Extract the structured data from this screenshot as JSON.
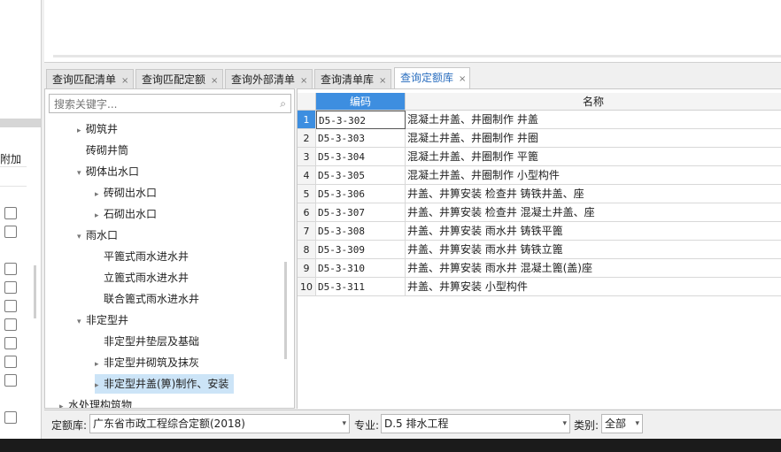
{
  "left_strip": {
    "column_label": "附加"
  },
  "tabs": [
    {
      "label": "查询匹配清单",
      "close": "×"
    },
    {
      "label": "查询匹配定额",
      "close": "×"
    },
    {
      "label": "查询外部清单",
      "close": "×"
    },
    {
      "label": "查询清单库",
      "close": "×"
    },
    {
      "label": "查询定额库",
      "close": "×",
      "active": true
    }
  ],
  "search": {
    "placeholder": "搜索关键字...",
    "icon": "search-icon"
  },
  "tree": [
    {
      "label": "砌筑井",
      "arrow": "▸",
      "indent": 1
    },
    {
      "label": "砖砌井筒",
      "arrow": "",
      "indent": 1
    },
    {
      "label": "砌体出水口",
      "arrow": "▾",
      "indent": 1
    },
    {
      "label": "砖砌出水口",
      "arrow": "▸",
      "indent": 2
    },
    {
      "label": "石砌出水口",
      "arrow": "▸",
      "indent": 2
    },
    {
      "label": "雨水口",
      "arrow": "▾",
      "indent": 1
    },
    {
      "label": "平篦式雨水进水井",
      "arrow": "",
      "indent": 2
    },
    {
      "label": "立篦式雨水进水井",
      "arrow": "",
      "indent": 2
    },
    {
      "label": "联合篦式雨水进水井",
      "arrow": "",
      "indent": 2
    },
    {
      "label": "非定型井",
      "arrow": "▾",
      "indent": 1
    },
    {
      "label": "非定型井垫层及基础",
      "arrow": "",
      "indent": 2
    },
    {
      "label": "非定型井砌筑及抹灰",
      "arrow": "▸",
      "indent": 2
    },
    {
      "label": "非定型井盖(箅)制作、安装",
      "arrow": "▸",
      "indent": 2,
      "selected": true
    },
    {
      "label": "水处理构筑物",
      "arrow": "▸",
      "indent": 0
    }
  ],
  "grid": {
    "headers": {
      "code": "编码",
      "name": "名称"
    },
    "rows": [
      {
        "num": "1",
        "code": "D5-3-302",
        "name": "混凝土井盖、井圈制作 井盖"
      },
      {
        "num": "2",
        "code": "D5-3-303",
        "name": "混凝土井盖、井圈制作 井圈"
      },
      {
        "num": "3",
        "code": "D5-3-304",
        "name": "混凝土井盖、井圈制作 平篦"
      },
      {
        "num": "4",
        "code": "D5-3-305",
        "name": "混凝土井盖、井圈制作 小型构件"
      },
      {
        "num": "5",
        "code": "D5-3-306",
        "name": "井盖、井箅安装 检查井 铸铁井盖、座"
      },
      {
        "num": "6",
        "code": "D5-3-307",
        "name": "井盖、井箅安装 检查井 混凝土井盖、座"
      },
      {
        "num": "7",
        "code": "D5-3-308",
        "name": "井盖、井箅安装 雨水井 铸铁平篦"
      },
      {
        "num": "8",
        "code": "D5-3-309",
        "name": "井盖、井箅安装 雨水井 铸铁立篦"
      },
      {
        "num": "9",
        "code": "D5-3-310",
        "name": "井盖、井箅安装 雨水井 混凝土篦(盖)座"
      },
      {
        "num": "10",
        "code": "D5-3-311",
        "name": "井盖、井箅安装 小型构件"
      }
    ]
  },
  "bottom": {
    "quota_label": "定额库:",
    "quota_value": "广东省市政工程综合定额(2018)",
    "specialty_label": "专业:",
    "specialty_value": "D.5 排水工程",
    "category_label": "类别:",
    "category_value": "全部",
    "dropdown_icon": "▾"
  },
  "colors": {
    "accent": "#3d8ee0",
    "selected_row": "#cce4f7",
    "tab_active_text": "#2a6ebf"
  }
}
